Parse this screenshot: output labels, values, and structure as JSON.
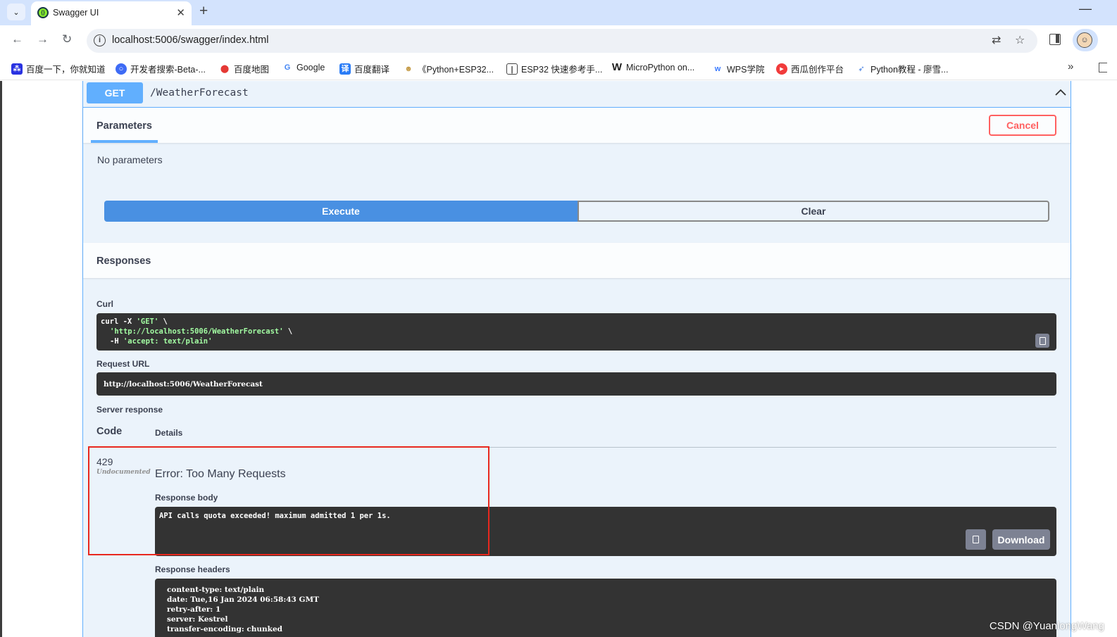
{
  "browser": {
    "tab_title": "Swagger UI",
    "url": "localhost:5006/swagger/index.html",
    "bookmarks": [
      {
        "label": "百度一下，你就知道",
        "icon": "baidu-paw-icon",
        "color": "#2932e1"
      },
      {
        "label": "开发者搜索-Beta-...",
        "icon": "developer-search-icon",
        "color": "#3e6bf5"
      },
      {
        "label": "百度地图",
        "icon": "map-pin-icon",
        "color": "#e53935"
      },
      {
        "label": "Google",
        "icon": "google-g-icon",
        "color": "#4285f4"
      },
      {
        "label": "百度翻译",
        "icon": "translate-icon",
        "color": "#2a7cf6"
      },
      {
        "label": "《Python+ESP32...",
        "icon": "emoji-icon",
        "color": "#c49a45"
      },
      {
        "label": "ESP32 快速参考手...",
        "icon": "doc-icon",
        "color": "#444444"
      },
      {
        "label": "MicroPython on...",
        "icon": "micropython-w-icon",
        "color": "#222222"
      },
      {
        "label": "WPS学院",
        "icon": "wps-icon",
        "color": "#3b7bff"
      },
      {
        "label": "西瓜创作平台",
        "icon": "xigua-icon",
        "color": "#f13b3b"
      },
      {
        "label": "Python教程 - 廖雪...",
        "icon": "rocket-icon",
        "color": "#3f7be0"
      }
    ]
  },
  "operation": {
    "method": "GET",
    "path": "/WeatherForecast",
    "params_tab": "Parameters",
    "cancel_label": "Cancel",
    "no_params": "No parameters",
    "execute_label": "Execute",
    "clear_label": "Clear"
  },
  "responses": {
    "title": "Responses",
    "curl_label": "Curl",
    "curl": {
      "l1_cmd": "curl -X ",
      "l1_method": "'GET'",
      "l1_tail": " \\",
      "l2_url": "'http://localhost:5006/WeatherForecast'",
      "l2_tail": " \\",
      "l3_flag": "-H ",
      "l3_header": "'accept: text/plain'"
    },
    "request_url_label": "Request URL",
    "request_url": "http://localhost:5006/WeatherForecast",
    "server_response_label": "Server response",
    "col_code": "Code",
    "col_details": "Details",
    "status_code": "429",
    "undocumented": "Undocumented",
    "error_title": "Error: Too Many Requests",
    "response_body_label": "Response body",
    "response_body": "API calls quota exceeded! maximum admitted 1 per 1s.",
    "download_label": "Download",
    "response_headers_label": "Response headers",
    "headers": [
      "content-type: text/plain",
      "date: Tue,16 Jan 2024 06:58:43 GMT",
      "retry-after: 1",
      "server: Kestrel",
      "transfer-encoding: chunked"
    ]
  },
  "watermark": "CSDN @YuanlongWang",
  "colors": {
    "get_blue": "#61affe",
    "execute_blue": "#4990e2",
    "cancel_red": "#ff6060",
    "highlight_red": "#e8281e",
    "code_bg": "#333333"
  }
}
